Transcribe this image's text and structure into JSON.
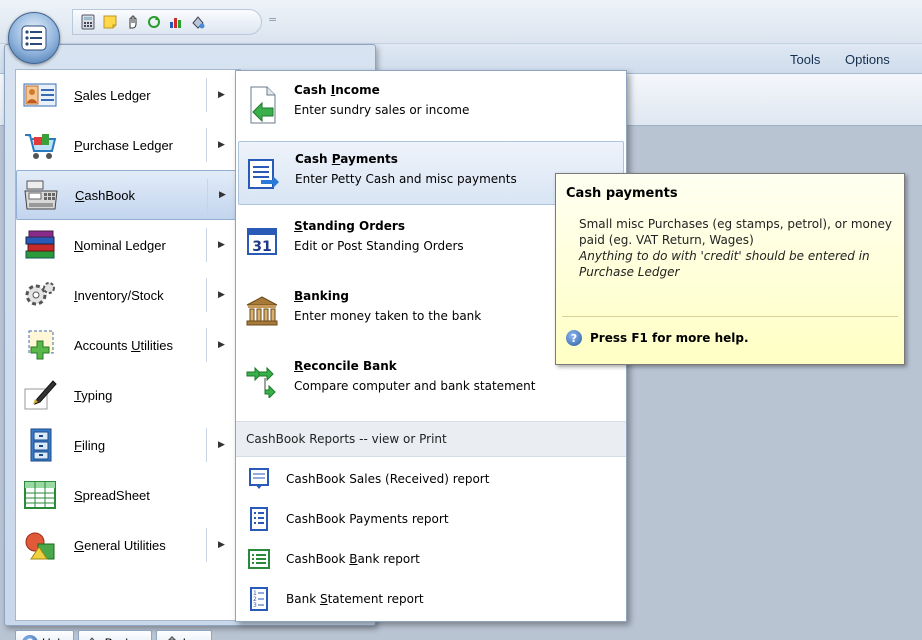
{
  "quick_access": {
    "icons": [
      "calculator-icon",
      "sticky-note-icon",
      "hand-pointer-icon",
      "refresh-icon",
      "bar-chart-icon",
      "backup-icon"
    ],
    "more_glyph": "="
  },
  "ribbon": {
    "tabs": [
      {
        "label": "Tools"
      },
      {
        "label": "Options"
      }
    ]
  },
  "left_menu": {
    "items": [
      {
        "label": "Sales Ledger",
        "accel_pre": "",
        "accel": "S",
        "accel_post": "ales Ledger",
        "has_submenu": true,
        "icon": "sales-ledger-icon"
      },
      {
        "label": "Purchase Ledger",
        "accel_pre": "",
        "accel": "P",
        "accel_post": "urchase Ledger",
        "has_submenu": true,
        "icon": "shopping-cart-icon"
      },
      {
        "label": "CashBook",
        "accel_pre": "",
        "accel": "C",
        "accel_post": "ashBook",
        "has_submenu": true,
        "active": true,
        "icon": "cash-register-icon"
      },
      {
        "label": "Nominal Ledger",
        "accel_pre": "",
        "accel": "N",
        "accel_post": "ominal Ledger",
        "has_submenu": true,
        "icon": "books-icon"
      },
      {
        "label": "Inventory/Stock",
        "accel_pre": "",
        "accel": "I",
        "accel_post": "nventory/Stock",
        "has_submenu": true,
        "icon": "gears-icon"
      },
      {
        "label": "Accounts Utilities",
        "accel_pre": "Accounts ",
        "accel": "U",
        "accel_post": "tilities",
        "has_submenu": true,
        "icon": "accounts-utilities-icon"
      },
      {
        "label": "Typing",
        "accel_pre": "",
        "accel": "T",
        "accel_post": "yping",
        "has_submenu": false,
        "icon": "pen-icon"
      },
      {
        "label": "Filing",
        "accel_pre": "",
        "accel": "F",
        "accel_post": "iling",
        "has_submenu": true,
        "icon": "filing-cabinet-icon"
      },
      {
        "label": "SpreadSheet",
        "accel_pre": "",
        "accel": "S",
        "accel_post": "preadSheet",
        "has_submenu": false,
        "icon": "spreadsheet-icon"
      },
      {
        "label": "General Utilities",
        "accel_pre": "",
        "accel": "G",
        "accel_post": "eneral Utilities",
        "has_submenu": true,
        "icon": "shapes-icon"
      }
    ]
  },
  "bottom_bar": {
    "help": {
      "accel": "H",
      "rest": "elp"
    },
    "backup": {
      "accel": "B",
      "rest": "ackup"
    },
    "logout": {
      "pre": "",
      "accel": "L",
      "rest": "o"
    }
  },
  "submenu": {
    "items": [
      {
        "title_pre": "Cash ",
        "title_accel": "I",
        "title_post": "ncome",
        "desc": "Enter sundry sales or income",
        "icon": "document-arrow-icon"
      },
      {
        "title_pre": "Cash ",
        "title_accel": "P",
        "title_post": "ayments",
        "desc": "Enter Petty Cash and misc payments",
        "icon": "payments-list-icon",
        "hover": true
      },
      {
        "title_pre": "",
        "title_accel": "S",
        "title_post": "tanding Orders",
        "desc": "Edit or Post Standing Orders",
        "icon": "calendar-icon",
        "calendar_day": "31"
      },
      {
        "title_pre": "",
        "title_accel": "B",
        "title_post": "anking",
        "desc": "Enter money taken to the bank",
        "icon": "bank-icon"
      },
      {
        "title_pre": "",
        "title_accel": "R",
        "title_post": "econcile Bank",
        "desc": "Compare computer and bank statement",
        "icon": "reconcile-arrows-icon"
      }
    ],
    "reports_header": "CashBook Reports -- view or Print",
    "reports": [
      {
        "pre": "CashBook Sales (Received) report",
        "accel": "",
        "post": "",
        "icon": "report-received-icon"
      },
      {
        "pre": "CashBook Payments report",
        "accel": "",
        "post": "",
        "icon": "report-payments-icon"
      },
      {
        "pre": "CashBook ",
        "accel": "B",
        "post": "ank report",
        "icon": "report-bank-icon"
      },
      {
        "pre": "Bank ",
        "accel": "S",
        "post": "tatement report",
        "icon": "report-statement-icon"
      }
    ]
  },
  "tooltip": {
    "title": "Cash payments",
    "body": "Small misc Purchases (eg stamps, petrol), or money paid (eg. VAT Return, Wages)",
    "italic": "Anything to do with 'credit' should be entered in Purchase Ledger",
    "help_text": "Press F1 for more help.",
    "help_glyph": "?"
  },
  "colors": {
    "accent": "#3f6fa8",
    "tooltip_bg": "#ffffc4",
    "active_item": "#c2d5ee"
  }
}
